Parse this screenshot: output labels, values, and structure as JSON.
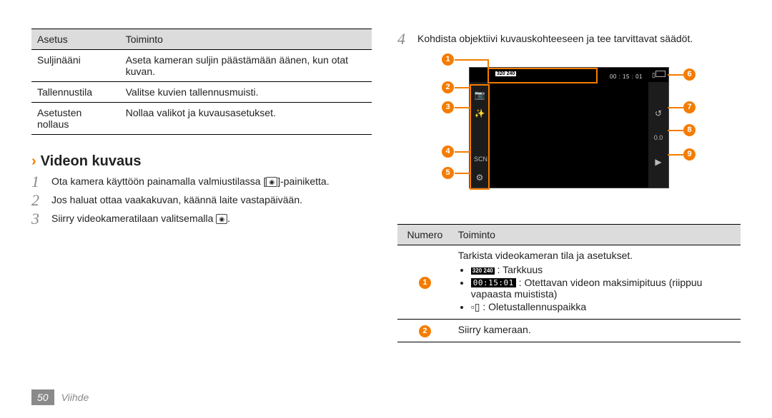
{
  "footer": {
    "page": "50",
    "section": "Viihde"
  },
  "left": {
    "table": {
      "headers": [
        "Asetus",
        "Toiminto"
      ],
      "rows": [
        [
          "Suljinääni",
          "Aseta kameran suljin päästämään äänen, kun otat kuvan."
        ],
        [
          "Tallennustila",
          "Valitse kuvien tallennusmuisti."
        ],
        [
          "Asetusten nollaus",
          "Nollaa valikot ja kuvausasetukset."
        ]
      ]
    },
    "heading": "Videon kuvaus",
    "steps": {
      "s1_a": "Ota kamera käyttöön painamalla valmiustilassa [",
      "s1_icon": "◉",
      "s1_b": "]-painiketta.",
      "s2": "Jos haluat ottaa vaakakuvan, käännä laite vastapäivään.",
      "s3_a": "Siirry videokameratilaan valitsemalla ",
      "s3_icon": "◉",
      "s3_b": "."
    }
  },
  "right": {
    "step4": "Kohdista objektiivi kuvauskohteeseen ja tee tarvittavat säädöt.",
    "screen": {
      "resolution": "320\n240",
      "time": "00 : 15 : 01",
      "storage": "▯",
      "callouts": {
        "c1": "1",
        "c2": "2",
        "c3": "3",
        "c4": "4",
        "c5": "5",
        "c6": "6",
        "c7": "7",
        "c8": "8",
        "c9": "9"
      }
    },
    "table": {
      "headers": [
        "Numero",
        "Toiminto"
      ],
      "row1": {
        "num": "1",
        "lead": "Tarkista videokameran tila ja asetukset.",
        "b1_icon": "320\n240",
        "b1_text": ": Tarkkuus",
        "b2_icon": "00:15:01",
        "b2_text": ": Otettavan videon maksimipituus (riippuu vapaasta muistista)",
        "b3_icon": "▫▯",
        "b3_text": ": Oletustallennuspaikka"
      },
      "row2": {
        "num": "2",
        "text": "Siirry kameraan."
      }
    }
  }
}
